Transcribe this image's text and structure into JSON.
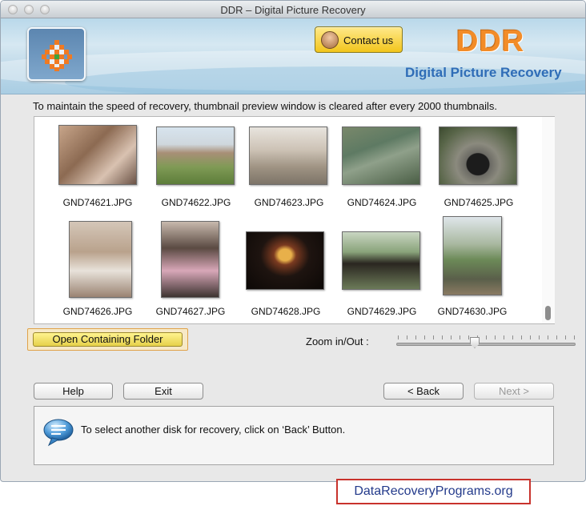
{
  "window": {
    "title": "DDR – Digital Picture Recovery"
  },
  "header": {
    "contact_label": "Contact us",
    "brand": "DDR",
    "product": "Digital Picture Recovery"
  },
  "notice": "To maintain the speed of recovery, thumbnail preview window is cleared after every 2000 thumbnails.",
  "thumbnails": [
    {
      "name": "GND74621.JPG"
    },
    {
      "name": "GND74622.JPG"
    },
    {
      "name": "GND74623.JPG"
    },
    {
      "name": "GND74624.JPG"
    },
    {
      "name": "GND74625.JPG"
    },
    {
      "name": "GND74626.JPG"
    },
    {
      "name": "GND74627.JPG"
    },
    {
      "name": "GND74628.JPG"
    },
    {
      "name": "GND74629.JPG"
    },
    {
      "name": "GND74630.JPG"
    }
  ],
  "actions": {
    "open_folder": "Open Containing Folder",
    "zoom_label": "Zoom in/Out :",
    "zoom_level": 0.43
  },
  "buttons": {
    "help": "Help",
    "exit": "Exit",
    "back": "< Back",
    "next": "Next >"
  },
  "info": {
    "message": "To select another disk for recovery, click on ‘Back’ Button.",
    "icon": "chat-bubble-icon"
  },
  "footer": {
    "link": "DataRecoveryPrograms.org"
  },
  "colors": {
    "accent_orange": "#f28c28",
    "brand_blue": "#2f6db7",
    "highlight_yellow": "#f2c51c"
  }
}
